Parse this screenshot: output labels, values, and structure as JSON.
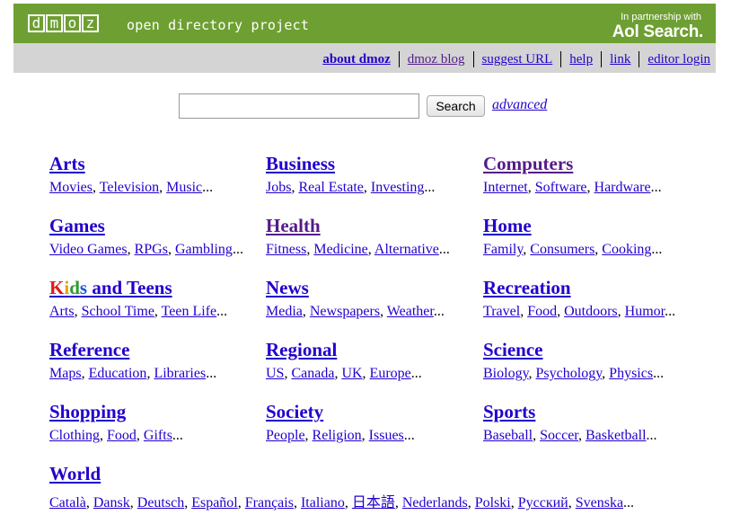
{
  "header": {
    "logo_letters": [
      "d",
      "m",
      "o",
      "z"
    ],
    "tagline": "open directory project",
    "partner_small": "In partnership with",
    "partner_brand": "Aol Search."
  },
  "nav": {
    "links": [
      {
        "label": "about dmoz",
        "bold": true
      },
      {
        "label": "dmoz blog",
        "visited": true
      },
      {
        "label": "suggest URL"
      },
      {
        "label": "help"
      },
      {
        "label": "link"
      },
      {
        "label": "editor login"
      }
    ]
  },
  "search": {
    "input_value": "",
    "button_label": "Search",
    "advanced_label": "advanced"
  },
  "categories": [
    {
      "title": "Arts",
      "subs": [
        "Movies",
        "Television",
        "Music"
      ]
    },
    {
      "title": "Business",
      "subs": [
        "Jobs",
        "Real Estate",
        "Investing"
      ]
    },
    {
      "title": "Computers",
      "subs": [
        "Internet",
        "Software",
        "Hardware"
      ]
    },
    {
      "title": "Games",
      "subs": [
        "Video Games",
        "RPGs",
        "Gambling"
      ]
    },
    {
      "title": "Health",
      "subs": [
        "Fitness",
        "Medicine",
        "Alternative"
      ]
    },
    {
      "title": "Home",
      "subs": [
        "Family",
        "Consumers",
        "Cooking"
      ]
    },
    {
      "title": "Kids and Teens",
      "title_k": "K",
      "title_i": "i",
      "title_d": "d",
      "title_s": "s",
      "title_rest": " and Teens",
      "subs": [
        "Arts",
        "School Time",
        "Teen Life"
      ]
    },
    {
      "title": "News",
      "subs": [
        "Media",
        "Newspapers",
        "Weather"
      ]
    },
    {
      "title": "Recreation",
      "subs": [
        "Travel",
        "Food",
        "Outdoors",
        "Humor"
      ]
    },
    {
      "title": "Reference",
      "subs": [
        "Maps",
        "Education",
        "Libraries"
      ]
    },
    {
      "title": "Regional",
      "subs": [
        "US",
        "Canada",
        "UK",
        "Europe"
      ]
    },
    {
      "title": "Science",
      "subs": [
        "Biology",
        "Psychology",
        "Physics"
      ]
    },
    {
      "title": "Shopping",
      "subs": [
        "Clothing",
        "Food",
        "Gifts"
      ]
    },
    {
      "title": "Society",
      "subs": [
        "People",
        "Religion",
        "Issues"
      ]
    },
    {
      "title": "Sports",
      "subs": [
        "Baseball",
        "Soccer",
        "Basketball"
      ]
    },
    {
      "title": "World",
      "subs": [
        "Català",
        "Dansk",
        "Deutsch",
        "Español",
        "Français",
        "Italiano",
        "日本語",
        "Nederlands",
        "Polski",
        "Русский",
        "Svenska"
      ]
    }
  ],
  "ellipsis": "...",
  "separator": ", "
}
